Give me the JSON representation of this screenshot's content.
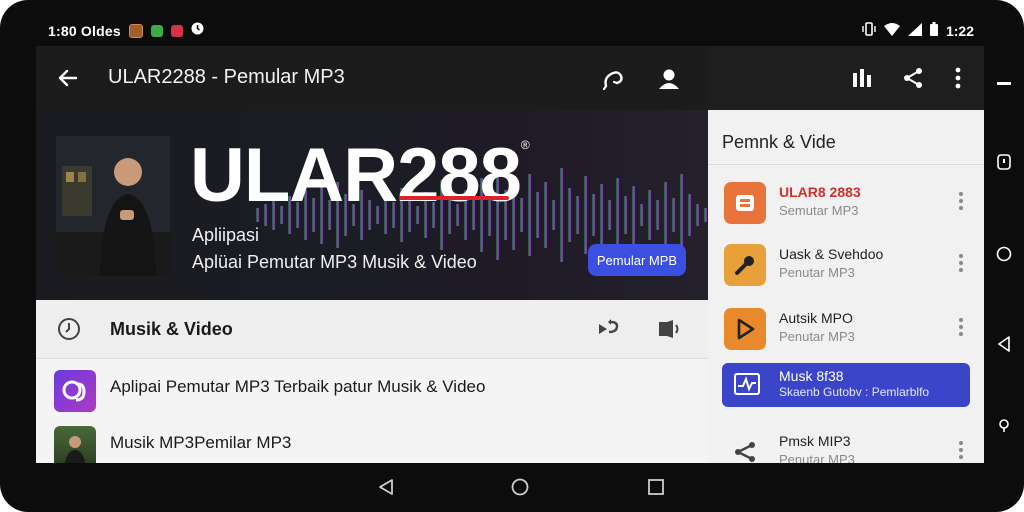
{
  "status_bar": {
    "left_text": "1:80 Oldes",
    "right_time": "1:22",
    "icons": [
      "notification-badge-brown",
      "notification-badge-green",
      "notification-badge-red",
      "alarm-icon",
      "vibrate-icon",
      "wifi-icon",
      "signal-icon",
      "battery-icon"
    ]
  },
  "app_bar": {
    "title": "ULAR2288 - Pemular MP3",
    "icons": [
      "back-arrow-icon",
      "link-icon",
      "account-icon",
      "equalizer-icon",
      "share-icon",
      "more-vert-icon"
    ]
  },
  "hero": {
    "brand": "ULAR288",
    "brand_registered": "®",
    "subtitle_1": "Apliipasi",
    "subtitle_2": "Aplüai Pemutar MP3  Musik & Video",
    "cta_label": "Pemular MPB"
  },
  "main": {
    "section_title": "Musik & Video",
    "section_icons": [
      "clock-icon",
      "repeat-icon",
      "volume-icon"
    ],
    "rows": [
      {
        "text": "Aplipai Pemutar MP3 Terbaik patur Musik & Video"
      },
      {
        "text": "Musik MP3Pemilar MP3"
      }
    ]
  },
  "side_panel": {
    "title": "Pemnk & Vide",
    "items": [
      {
        "title": "ULAR8 2883",
        "subtitle": "Semutar MP3",
        "icon": "player-icon",
        "active": false,
        "accent": "#e8743b"
      },
      {
        "title": "Uask & Svehdoo",
        "subtitle": "Penutar MP3",
        "icon": "microphone-icon",
        "active": false,
        "accent": "#e8a03b"
      },
      {
        "title": "Autsik MPO",
        "subtitle": "Penutar MP3",
        "icon": "play-icon",
        "active": false,
        "accent": "#e88a2b"
      },
      {
        "title": "Musk 8f38",
        "subtitle": "Skaenb Gutobv : Pemlarblfo",
        "icon": "waveform-icon",
        "active": true,
        "accent": "#3b45c9"
      },
      {
        "title": "Pmsk MIP3",
        "subtitle": "Penutar MP3",
        "icon": "share-nodes-icon",
        "active": false,
        "accent": "#f1f1f1"
      }
    ]
  },
  "colors": {
    "accent_blue": "#3b4fe0",
    "brand_red": "#e0202a",
    "dark_bar": "#1c1c1c"
  },
  "system_rail_icons": [
    "minimize-icon",
    "recent-icon",
    "home-circle-icon",
    "back-triangle-icon",
    "assistant-icon"
  ],
  "nav_bar_icons": [
    "back-triangle-icon",
    "home-circle-icon",
    "recents-square-icon"
  ]
}
